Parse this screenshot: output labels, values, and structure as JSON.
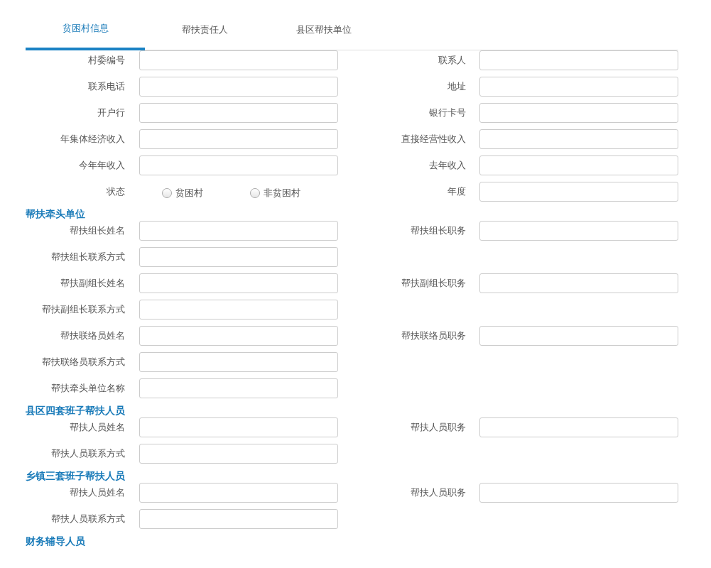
{
  "tabs": [
    {
      "label": "贫困村信息",
      "selected": true
    },
    {
      "label": "帮扶责任人",
      "selected": false
    },
    {
      "label": "县区帮扶单位",
      "selected": false
    }
  ],
  "sections": [
    {
      "rows": [
        [
          {
            "label": "村委编号",
            "kind": "input"
          },
          {
            "label": "联系人",
            "kind": "input"
          }
        ],
        [
          {
            "label": "联系电话",
            "kind": "input"
          },
          {
            "label": "地址",
            "kind": "input"
          }
        ],
        [
          {
            "label": "开户行",
            "kind": "input"
          },
          {
            "label": "银行卡号",
            "kind": "input"
          }
        ],
        [
          {
            "label": "年集体经济收入",
            "kind": "input"
          },
          {
            "label": "直接经营性收入",
            "kind": "input"
          }
        ],
        [
          {
            "label": "今年年收入",
            "kind": "input"
          },
          {
            "label": "去年收入",
            "kind": "input"
          }
        ],
        [
          {
            "label": "状态",
            "kind": "radio",
            "options": [
              {
                "label": "贫困村",
                "selected": false
              },
              {
                "label": "非贫困村",
                "selected": false
              }
            ]
          },
          {
            "label": "年度",
            "kind": "input"
          }
        ]
      ]
    },
    {
      "title": "帮扶牵头单位",
      "rows": [
        [
          {
            "label": "帮扶组长姓名",
            "kind": "input"
          },
          {
            "label": "帮扶组长职务",
            "kind": "input"
          }
        ],
        [
          {
            "label": "帮扶组长联系方式",
            "kind": "input"
          }
        ],
        [
          {
            "label": "帮扶副组长姓名",
            "kind": "input"
          },
          {
            "label": "帮扶副组长职务",
            "kind": "input"
          }
        ],
        [
          {
            "label": "帮扶副组长联系方式",
            "kind": "input"
          }
        ],
        [
          {
            "label": "帮扶联络员姓名",
            "kind": "input"
          },
          {
            "label": "帮扶联络员职务",
            "kind": "input"
          }
        ],
        [
          {
            "label": "帮扶联络员联系方式",
            "kind": "input"
          }
        ],
        [
          {
            "label": "帮扶牵头单位名称",
            "kind": "input"
          }
        ]
      ]
    },
    {
      "title": "县区四套班子帮扶人员",
      "rows": [
        [
          {
            "label": "帮扶人员姓名",
            "kind": "input"
          },
          {
            "label": "帮扶人员职务",
            "kind": "input"
          }
        ],
        [
          {
            "label": "帮扶人员联系方式",
            "kind": "input"
          }
        ]
      ]
    },
    {
      "title": "乡镇三套班子帮扶人员",
      "rows": [
        [
          {
            "label": "帮扶人员姓名",
            "kind": "input"
          },
          {
            "label": "帮扶人员职务",
            "kind": "input"
          }
        ],
        [
          {
            "label": "帮扶人员联系方式",
            "kind": "input"
          }
        ]
      ]
    },
    {
      "title": "财务辅导人员"
    }
  ]
}
